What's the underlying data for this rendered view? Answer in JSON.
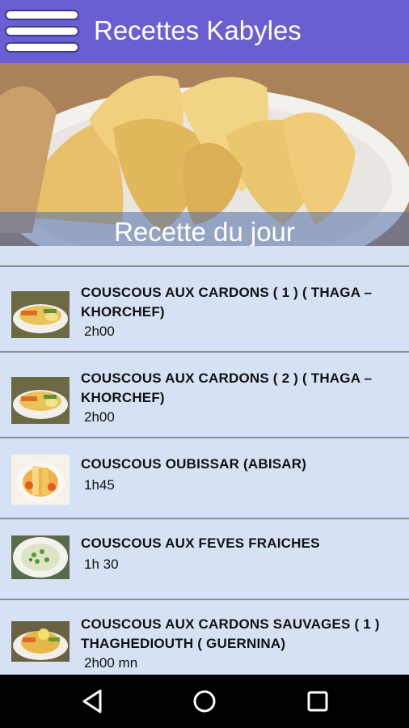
{
  "app": {
    "title": "Recettes Kabyles"
  },
  "hero": {
    "caption": "Recette du jour"
  },
  "recipes": [
    {
      "title": "COUSCOUS AUX CARDONS  ( 1 ) ( THAGA – KHORCHEF)",
      "time": "2h00"
    },
    {
      "title": "COUSCOUS AUX CARDONS  ( 2 ) ( THAGA – KHORCHEF)",
      "time": "2h00"
    },
    {
      "title": "COUSCOUS OUBISSAR (ABISAR)",
      "time": "1h45"
    },
    {
      "title": "COUSCOUS AUX FEVES FRAICHES",
      "time": "1h 30"
    },
    {
      "title": "COUSCOUS AUX CARDONS SAUVAGES ( 1 ) THAGHEDIOUTH ( GUERNINA)",
      "time": "2h00 mn"
    }
  ],
  "icons": {
    "menu": "hamburger-icon",
    "back": "back-triangle-icon",
    "home": "home-circle-icon",
    "recents": "recents-square-icon"
  },
  "colors": {
    "appbar": "#6a5fd2",
    "list_background": "#d6e1f5",
    "divider": "#8d8f96",
    "navbar": "#000000"
  }
}
